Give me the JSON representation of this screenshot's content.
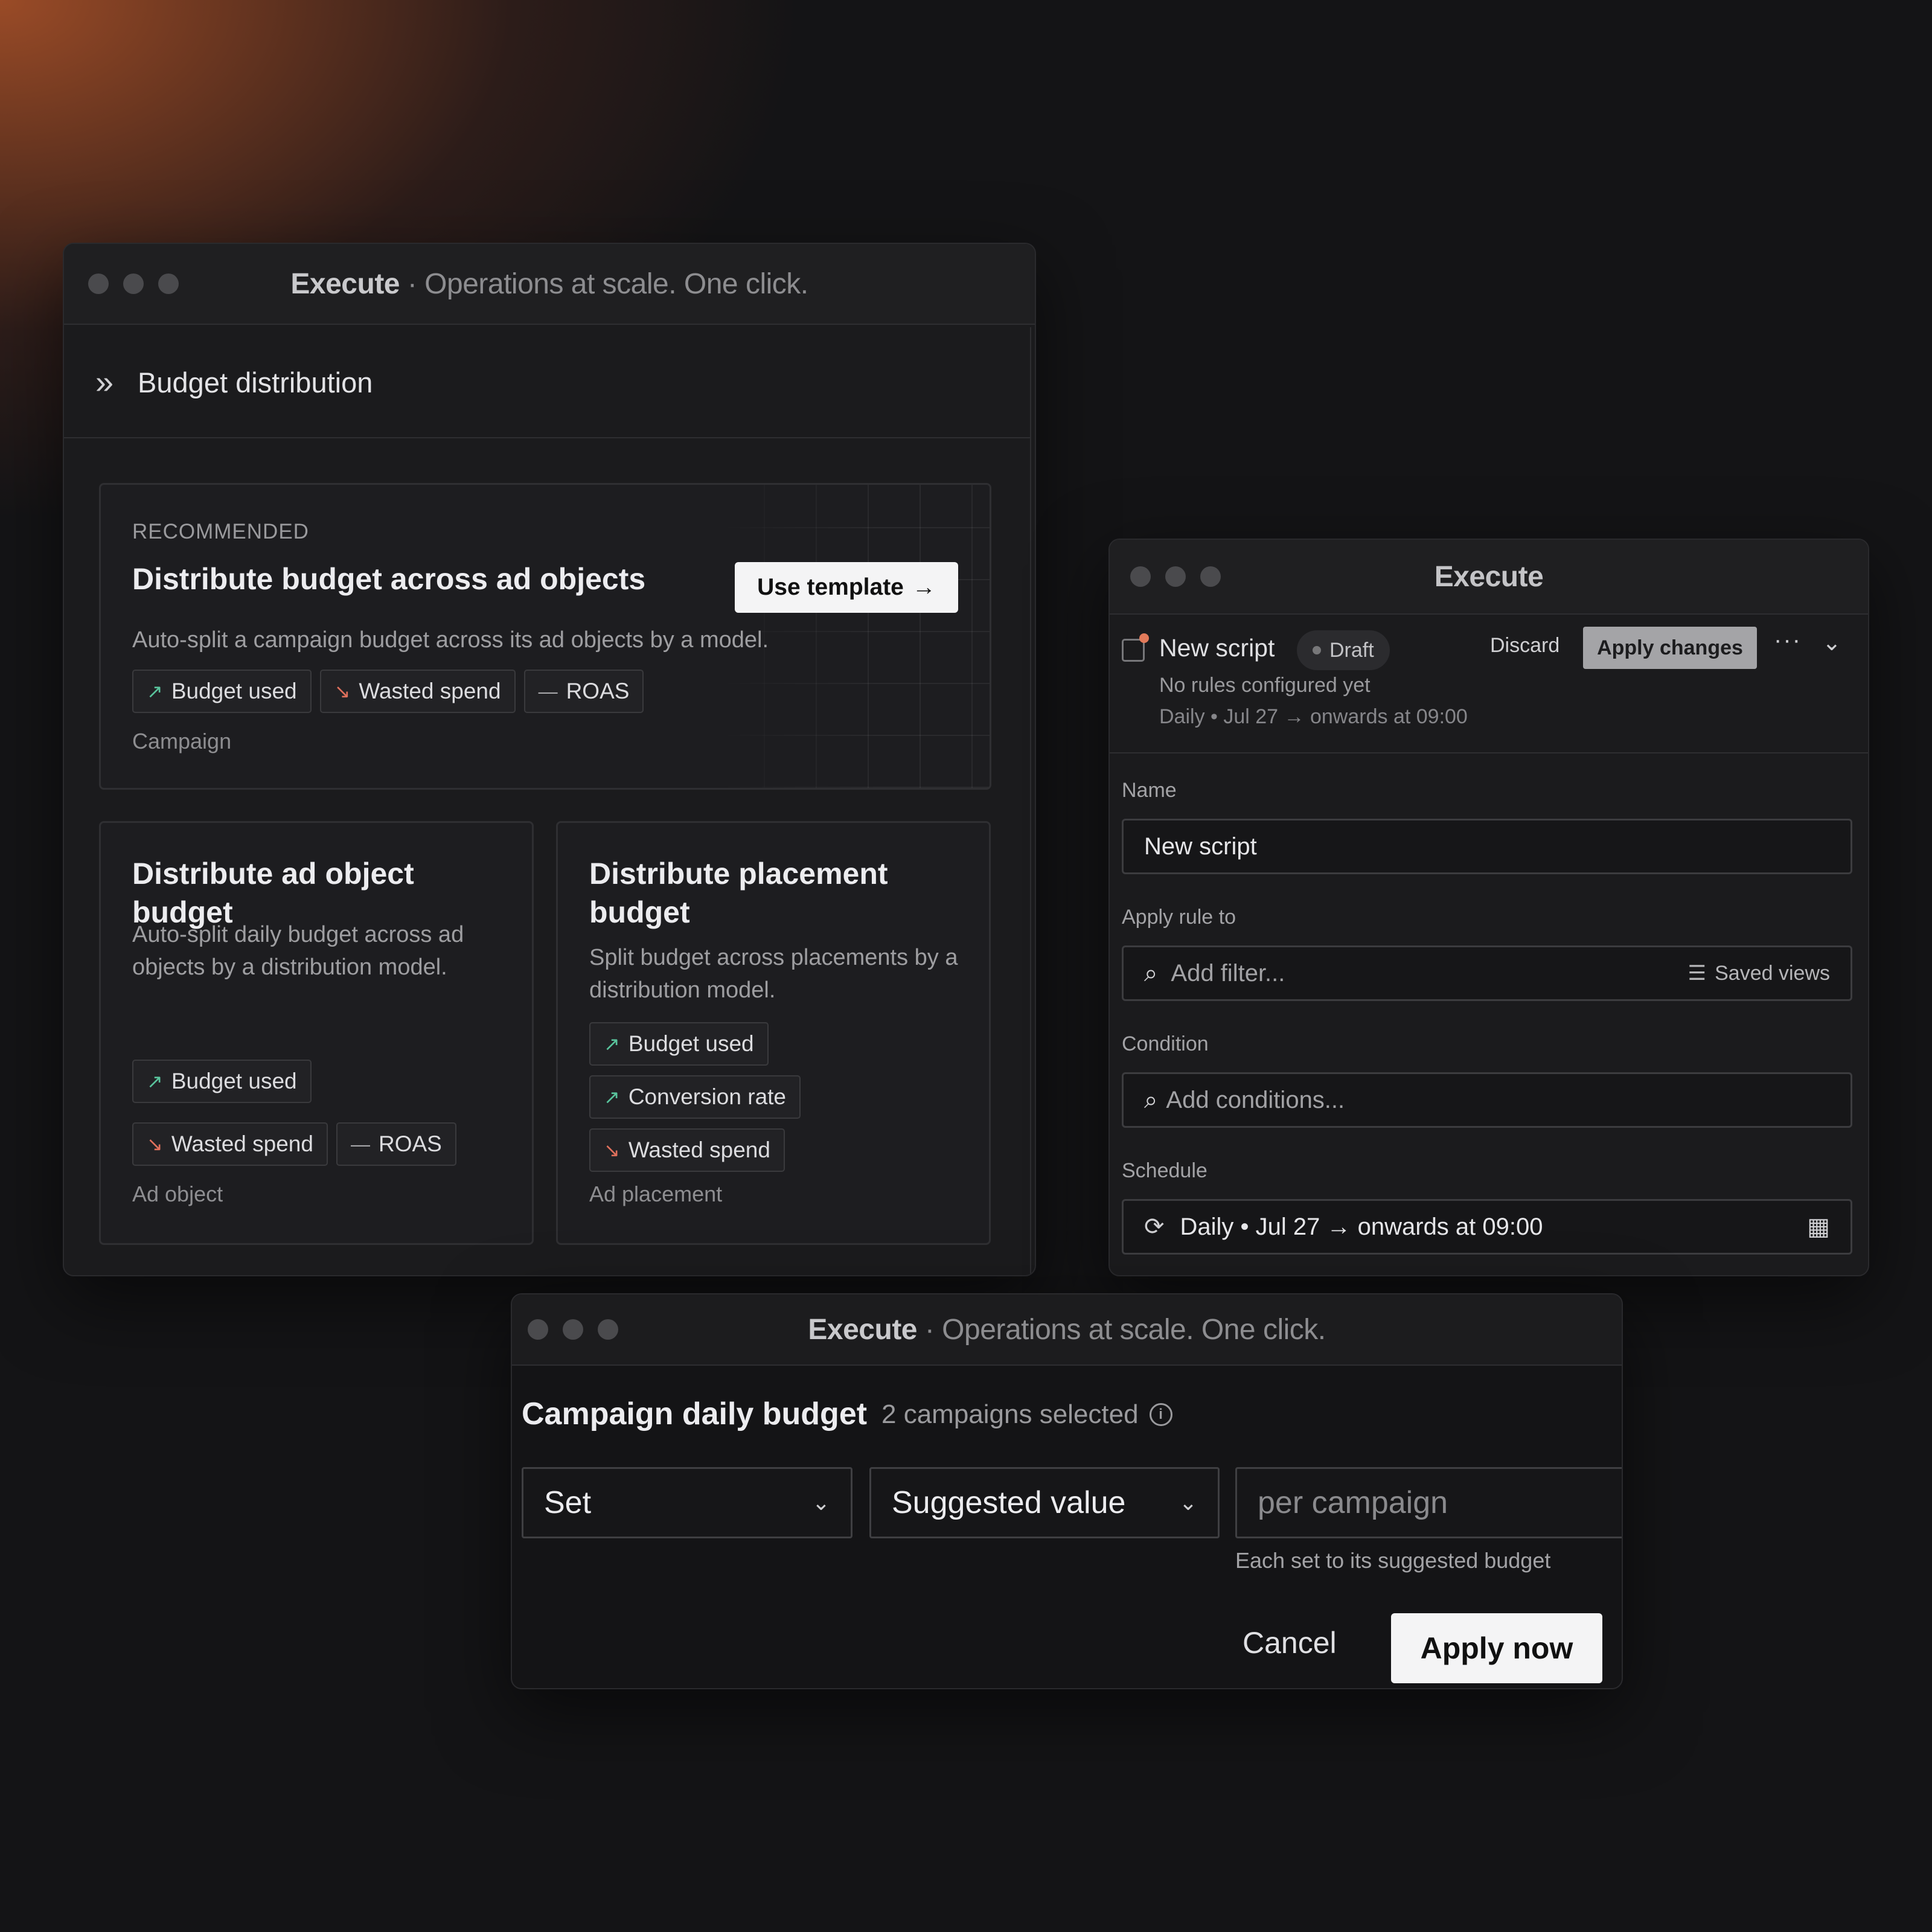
{
  "window_main": {
    "title_bold": "Execute",
    "title_rest": " · Operations at scale. One click.",
    "panel_title": "Budget distribution",
    "recommended": {
      "eyebrow": "RECOMMENDED",
      "title": "Distribute budget across ad objects",
      "button": "Use template",
      "description": "Auto-split a campaign budget across its ad objects by a model.",
      "tags": [
        {
          "label": "Budget used",
          "trend": "up"
        },
        {
          "label": "Wasted spend",
          "trend": "down"
        },
        {
          "label": "ROAS",
          "trend": "flat"
        }
      ],
      "footer": "Campaign"
    },
    "card_ad_object": {
      "title": "Distribute ad object budget",
      "description": "Auto-split daily budget across ad objects by a distribution model.",
      "tags": [
        {
          "label": "Budget used",
          "trend": "up"
        },
        {
          "label": "Wasted spend",
          "trend": "down"
        },
        {
          "label": "ROAS",
          "trend": "flat"
        }
      ],
      "footer": "Ad object"
    },
    "card_placement": {
      "title": "Distribute placement budget",
      "description": "Split budget across placements by a distribution model.",
      "tags": [
        {
          "label": "Budget used",
          "trend": "up"
        },
        {
          "label": "Conversion rate",
          "trend": "up"
        },
        {
          "label": "Wasted spend",
          "trend": "down"
        }
      ],
      "footer": "Ad placement"
    }
  },
  "window_script": {
    "title": "Execute",
    "script_name": "New script",
    "status": "Draft",
    "subtitle": "No rules configured yet",
    "schedule_summary": "Daily • Jul 27 → onwards at 09:00",
    "discard": "Discard",
    "apply_changes": "Apply changes",
    "name_label": "Name",
    "name_value": "New script",
    "apply_rule_label": "Apply rule to",
    "filter_placeholder": "Add filter...",
    "saved_views": "Saved views",
    "condition_label": "Condition",
    "condition_placeholder": "Add conditions...",
    "schedule_label": "Schedule",
    "schedule_value": "Daily • Jul 27 → onwards at 09:00"
  },
  "window_budget": {
    "title_bold": "Execute",
    "title_rest": " · Operations at scale. One click.",
    "heading": "Campaign daily budget",
    "selection": "2 campaigns selected",
    "action_select": "Set",
    "value_select": "Suggested value",
    "amount_placeholder": "per campaign",
    "hint": "Each set to its suggested budget",
    "cancel": "Cancel",
    "apply_now": "Apply now"
  },
  "colors": {
    "trend_up": "#59c39c",
    "trend_down": "#e0705c",
    "draft_dot": "#e27a5a"
  }
}
